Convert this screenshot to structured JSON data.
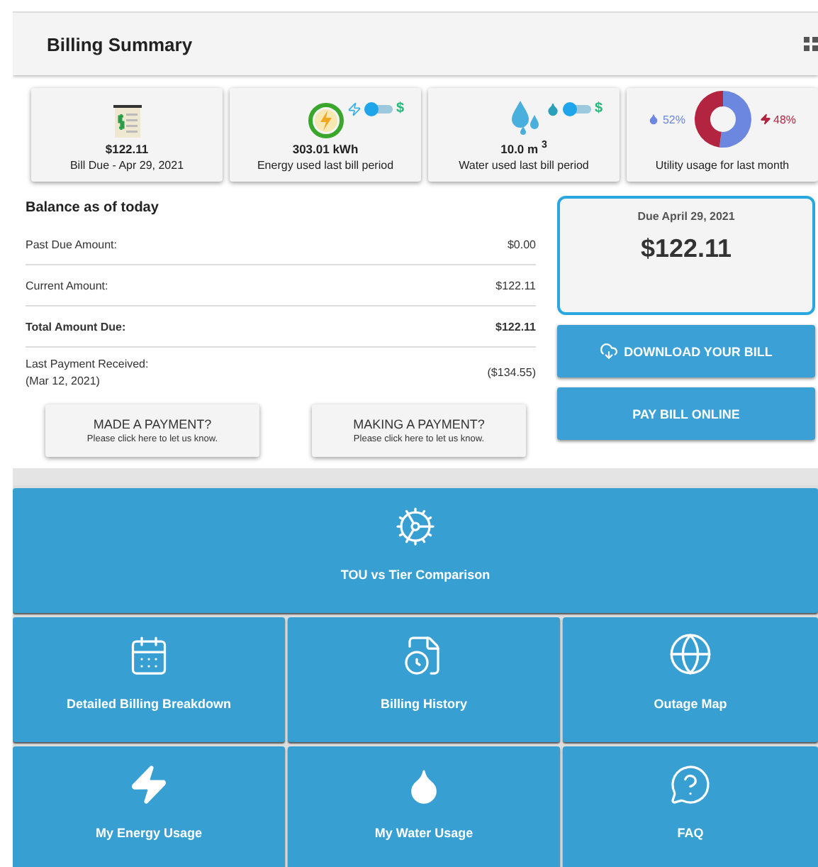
{
  "header": {
    "title": "Billing Summary"
  },
  "summary_cards": [
    {
      "kind": "bill",
      "value": "$122.11",
      "label": "Bill Due - Apr 29, 2021"
    },
    {
      "kind": "energy",
      "value": "303.01 kWh",
      "label": "Energy used last bill period",
      "toggle": {
        "on": false,
        "symbol": "$"
      }
    },
    {
      "kind": "water",
      "value": "10.0 m $^{3}$",
      "label": "Water used last bill period",
      "toggle": {
        "on": false,
        "symbol": "$"
      }
    },
    {
      "kind": "usage",
      "label": "Utility usage for last month",
      "chart_data": {
        "type": "donut",
        "values": [
          52,
          48
        ]
      },
      "legend": [
        {
          "kind": "water",
          "label": "52%",
          "color": "#6c87e0"
        },
        {
          "kind": "energy",
          "label": "48%",
          "color": "#b32440"
        }
      ]
    }
  ],
  "balance": {
    "title": "Balance as of today",
    "rows": [
      {
        "label": "Past Due Amount:",
        "value": "$0.00",
        "bold": false
      },
      {
        "label": "Current Amount:",
        "value": "$122.11",
        "bold": false
      },
      {
        "label": "Total Amount Due:",
        "value": "$122.11",
        "bold": true
      },
      {
        "label": "Last Payment Received:",
        "sublabel": "(Mar 12, 2021)",
        "value": "($134.55)",
        "bold": false
      }
    ]
  },
  "payment_buttons": [
    {
      "title": "MADE A PAYMENT?",
      "subtitle": "Please click here to let us know."
    },
    {
      "title": "MAKING A PAYMENT?",
      "subtitle": "Please click here to let us know."
    }
  ],
  "due_box": {
    "label": "Due April 29, 2021",
    "amount": "$122.11"
  },
  "actions": [
    {
      "kind": "download",
      "label": "DOWNLOAD YOUR BILL"
    },
    {
      "kind": "pay",
      "label": "PAY BILL ONLINE"
    }
  ],
  "tiles": [
    {
      "kind": "tou",
      "label": "TOU vs Tier Comparison"
    },
    {
      "kind": "breakdown",
      "label": "Detailed Billing Breakdown"
    },
    {
      "kind": "history",
      "label": "Billing History"
    },
    {
      "kind": "map",
      "label": "Outage Map"
    },
    {
      "kind": "energy",
      "label": "My Energy Usage"
    },
    {
      "kind": "water",
      "label": "My Water Usage"
    },
    {
      "kind": "faq",
      "label": "FAQ"
    }
  ]
}
